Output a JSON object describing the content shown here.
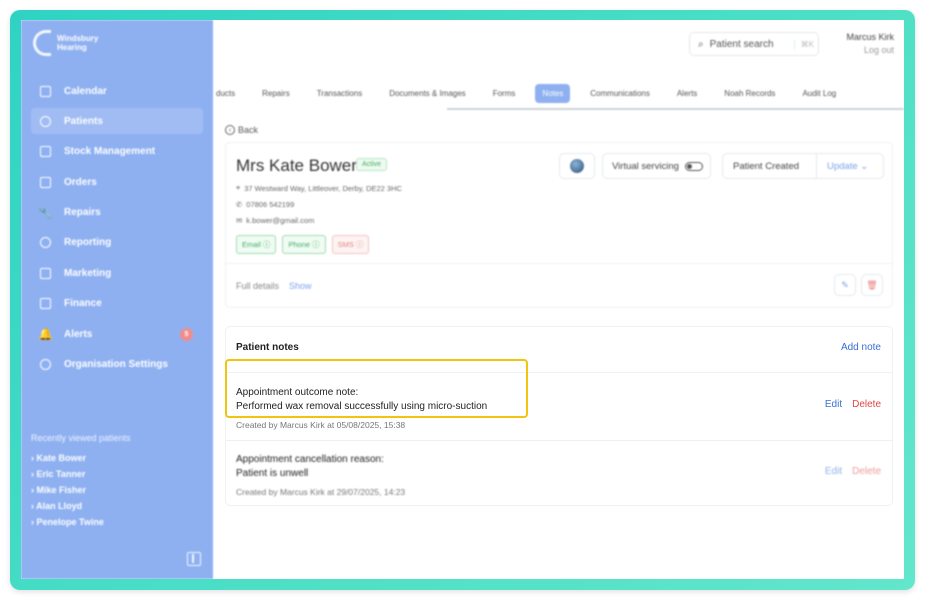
{
  "brand": {
    "name": "Windsbury Hearing"
  },
  "sidebar": {
    "items": [
      {
        "label": "Calendar"
      },
      {
        "label": "Patients"
      },
      {
        "label": "Stock Management"
      },
      {
        "label": "Orders"
      },
      {
        "label": "Repairs"
      },
      {
        "label": "Reporting"
      },
      {
        "label": "Marketing"
      },
      {
        "label": "Finance"
      },
      {
        "label": "Alerts",
        "badge": "5"
      },
      {
        "label": "Organisation Settings"
      }
    ],
    "recent_heading": "Recently viewed patients",
    "recent": [
      "Kate Bower",
      "Eric Tanner",
      "Mike Fisher",
      "Alan Lloyd",
      "Penelope Twine"
    ]
  },
  "header": {
    "search_label": "Patient search",
    "search_shortcut": "⌘K",
    "user_name": "Marcus Kirk",
    "logout": "Log out"
  },
  "tabs": [
    "ducts",
    "Repairs",
    "Transactions",
    "Documents & Images",
    "Forms",
    "Notes",
    "Communications",
    "Alerts",
    "Noah Records",
    "Audit Log"
  ],
  "active_tab": "Notes",
  "back_label": "Back",
  "patient": {
    "name": "Mrs Kate Bower",
    "status": "Active",
    "address": "37 Westward Way, Littleover, Derby, DE22 3HC",
    "phone": "07806 542199",
    "email": "k.bower@gmail.com",
    "chips": [
      "Email ⓘ",
      "Phone ⓘ",
      "SMS ⓘ"
    ],
    "virtual_servicing": "Virtual servicing",
    "patient_created": "Patient Created",
    "update": "Update ⌄",
    "full_details": "Full details",
    "show": "Show"
  },
  "notes": {
    "title": "Patient notes",
    "add": "Add note",
    "edit": "Edit",
    "delete": "Delete",
    "items": [
      {
        "line1": "Appointment outcome note:",
        "line2": "Performed wax removal successfully using micro-suction",
        "by": "Created by Marcus Kirk at 05/08/2025, 15:38"
      },
      {
        "line1": "Appointment cancellation reason:",
        "line2": "Patient is unwell",
        "by": "Created by Marcus Kirk at 29/07/2025, 14:23"
      }
    ]
  },
  "colors": {
    "sidebar": "#8eb0f1",
    "frame": "#3ed8c6",
    "highlight": "#f1c40f",
    "link": "#3a6fd1",
    "danger": "#e04646"
  }
}
